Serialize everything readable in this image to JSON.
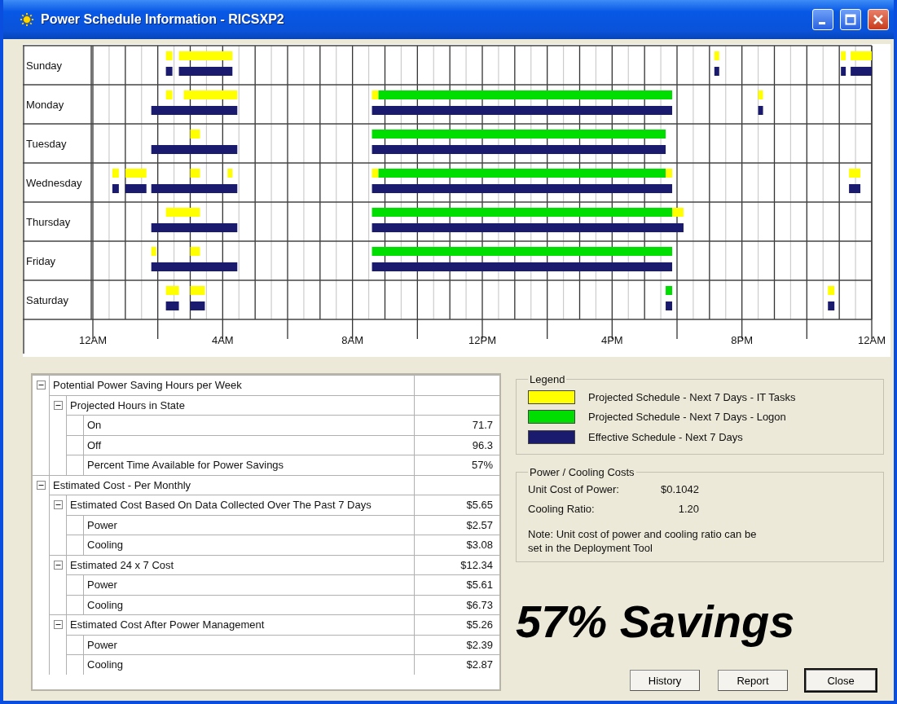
{
  "window": {
    "title": "Power Schedule Information - RICSXP2"
  },
  "schedule": {
    "axis_labels": [
      "12AM",
      "4AM",
      "8AM",
      "12PM",
      "4PM",
      "8PM",
      "12AM"
    ],
    "days": [
      "Sunday",
      "Monday",
      "Tuesday",
      "Wednesday",
      "Thursday",
      "Friday",
      "Saturday"
    ]
  },
  "cost_tree": [
    {
      "label": "Potential Power Saving Hours per Week",
      "expanded": true,
      "children": [
        {
          "label": "Projected Hours in State",
          "expanded": true,
          "children": [
            {
              "label": "On",
              "value": "71.7"
            },
            {
              "label": "Off",
              "value": "96.3"
            },
            {
              "label": "Percent Time Available for Power Savings",
              "value": "57%"
            }
          ]
        }
      ]
    },
    {
      "label": "Estimated Cost - Per Monthly",
      "expanded": true,
      "children": [
        {
          "label": "Estimated Cost Based On Data Collected Over The Past 7 Days",
          "value": "$5.65",
          "expanded": true,
          "children": [
            {
              "label": "Power",
              "value": "$2.57"
            },
            {
              "label": "Cooling",
              "value": "$3.08"
            }
          ]
        },
        {
          "label": "Estimated 24 x 7 Cost",
          "value": "$12.34",
          "expanded": true,
          "children": [
            {
              "label": "Power",
              "value": "$5.61"
            },
            {
              "label": "Cooling",
              "value": "$6.73"
            }
          ]
        },
        {
          "label": "Estimated Cost After Power Management",
          "value": "$5.26",
          "expanded": true,
          "children": [
            {
              "label": "Power",
              "value": "$2.39"
            },
            {
              "label": "Cooling",
              "value": "$2.87"
            }
          ]
        }
      ]
    }
  ],
  "legend": {
    "title": "Legend",
    "items": [
      {
        "label": "Projected Schedule - Next 7 Days - IT Tasks",
        "color": "#ffff00"
      },
      {
        "label": "Projected Schedule - Next 7 Days - Logon",
        "color": "#00dd00"
      },
      {
        "label": "Effective Schedule - Next 7 Days",
        "color": "#1a1a6e"
      }
    ]
  },
  "costs": {
    "title": "Power / Cooling Costs",
    "rows": [
      {
        "label": "Unit Cost of Power:",
        "value": "$0.1042"
      },
      {
        "label": "Cooling Ratio:",
        "value": "1.20"
      }
    ],
    "note": "Note:  Unit cost of power and cooling ratio can be set in the Deployment Tool"
  },
  "savings": "57% Savings",
  "buttons": [
    {
      "label": "History",
      "default": false
    },
    {
      "label": "Report",
      "default": false
    },
    {
      "label": "Close",
      "default": true
    }
  ]
}
